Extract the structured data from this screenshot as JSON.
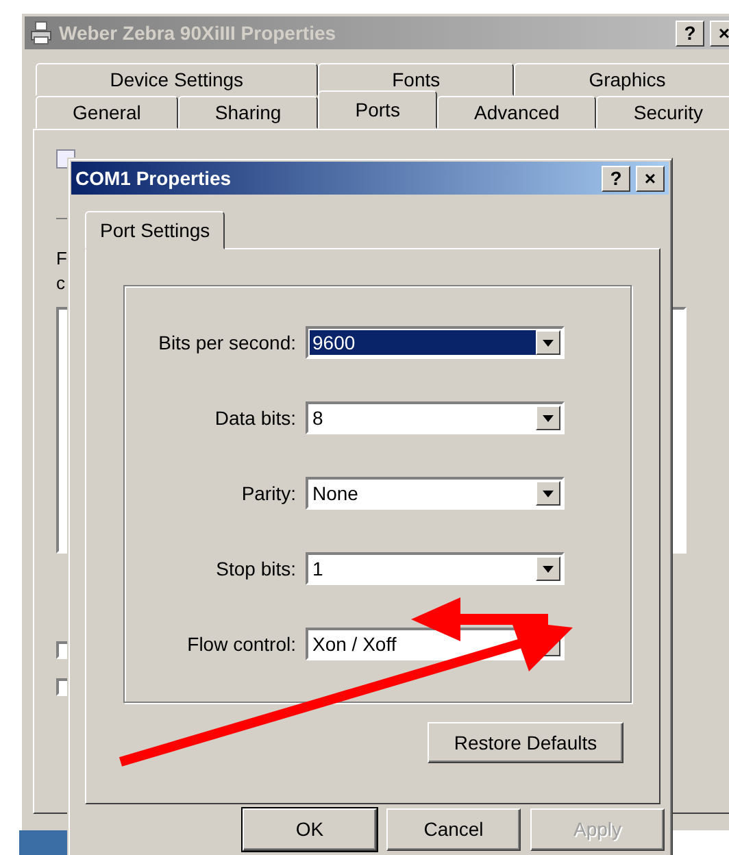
{
  "background_window": {
    "title": "Weber Zebra 90XiIII Properties",
    "title_buttons": [
      "?",
      "×"
    ],
    "tab_rows": [
      [
        {
          "label": "Device Settings",
          "selected": false
        },
        {
          "label": "Fonts",
          "selected": false
        },
        {
          "label": "Graphics",
          "selected": false
        }
      ],
      [
        {
          "label": "General",
          "selected": false
        },
        {
          "label": "Sharing",
          "selected": false
        },
        {
          "label": "Ports",
          "selected": true
        },
        {
          "label": "Advanced",
          "selected": false
        },
        {
          "label": "Security",
          "selected": false
        }
      ]
    ],
    "text_fragments": [
      "F",
      "c"
    ],
    "checkboxes": [
      {
        "checked": false
      },
      {
        "checked": false
      }
    ]
  },
  "dialog": {
    "title": "COM1 Properties",
    "title_buttons": [
      "?",
      "×"
    ],
    "tabs": [
      {
        "label": "Port Settings",
        "selected": true
      }
    ],
    "fields": [
      {
        "label": "Bits per second:",
        "value": "9600",
        "focused": true
      },
      {
        "label": "Data bits:",
        "value": "8",
        "focused": false
      },
      {
        "label": "Parity:",
        "value": "None",
        "focused": false
      },
      {
        "label": "Stop bits:",
        "value": "1",
        "focused": false
      },
      {
        "label": "Flow control:",
        "value": "Xon / Xoff",
        "focused": false
      }
    ],
    "restore_button": "Restore Defaults",
    "buttons": [
      {
        "label": "OK",
        "disabled": false,
        "default": true
      },
      {
        "label": "Cancel",
        "disabled": false,
        "default": false
      },
      {
        "label": "Apply",
        "disabled": true,
        "default": false
      }
    ]
  }
}
